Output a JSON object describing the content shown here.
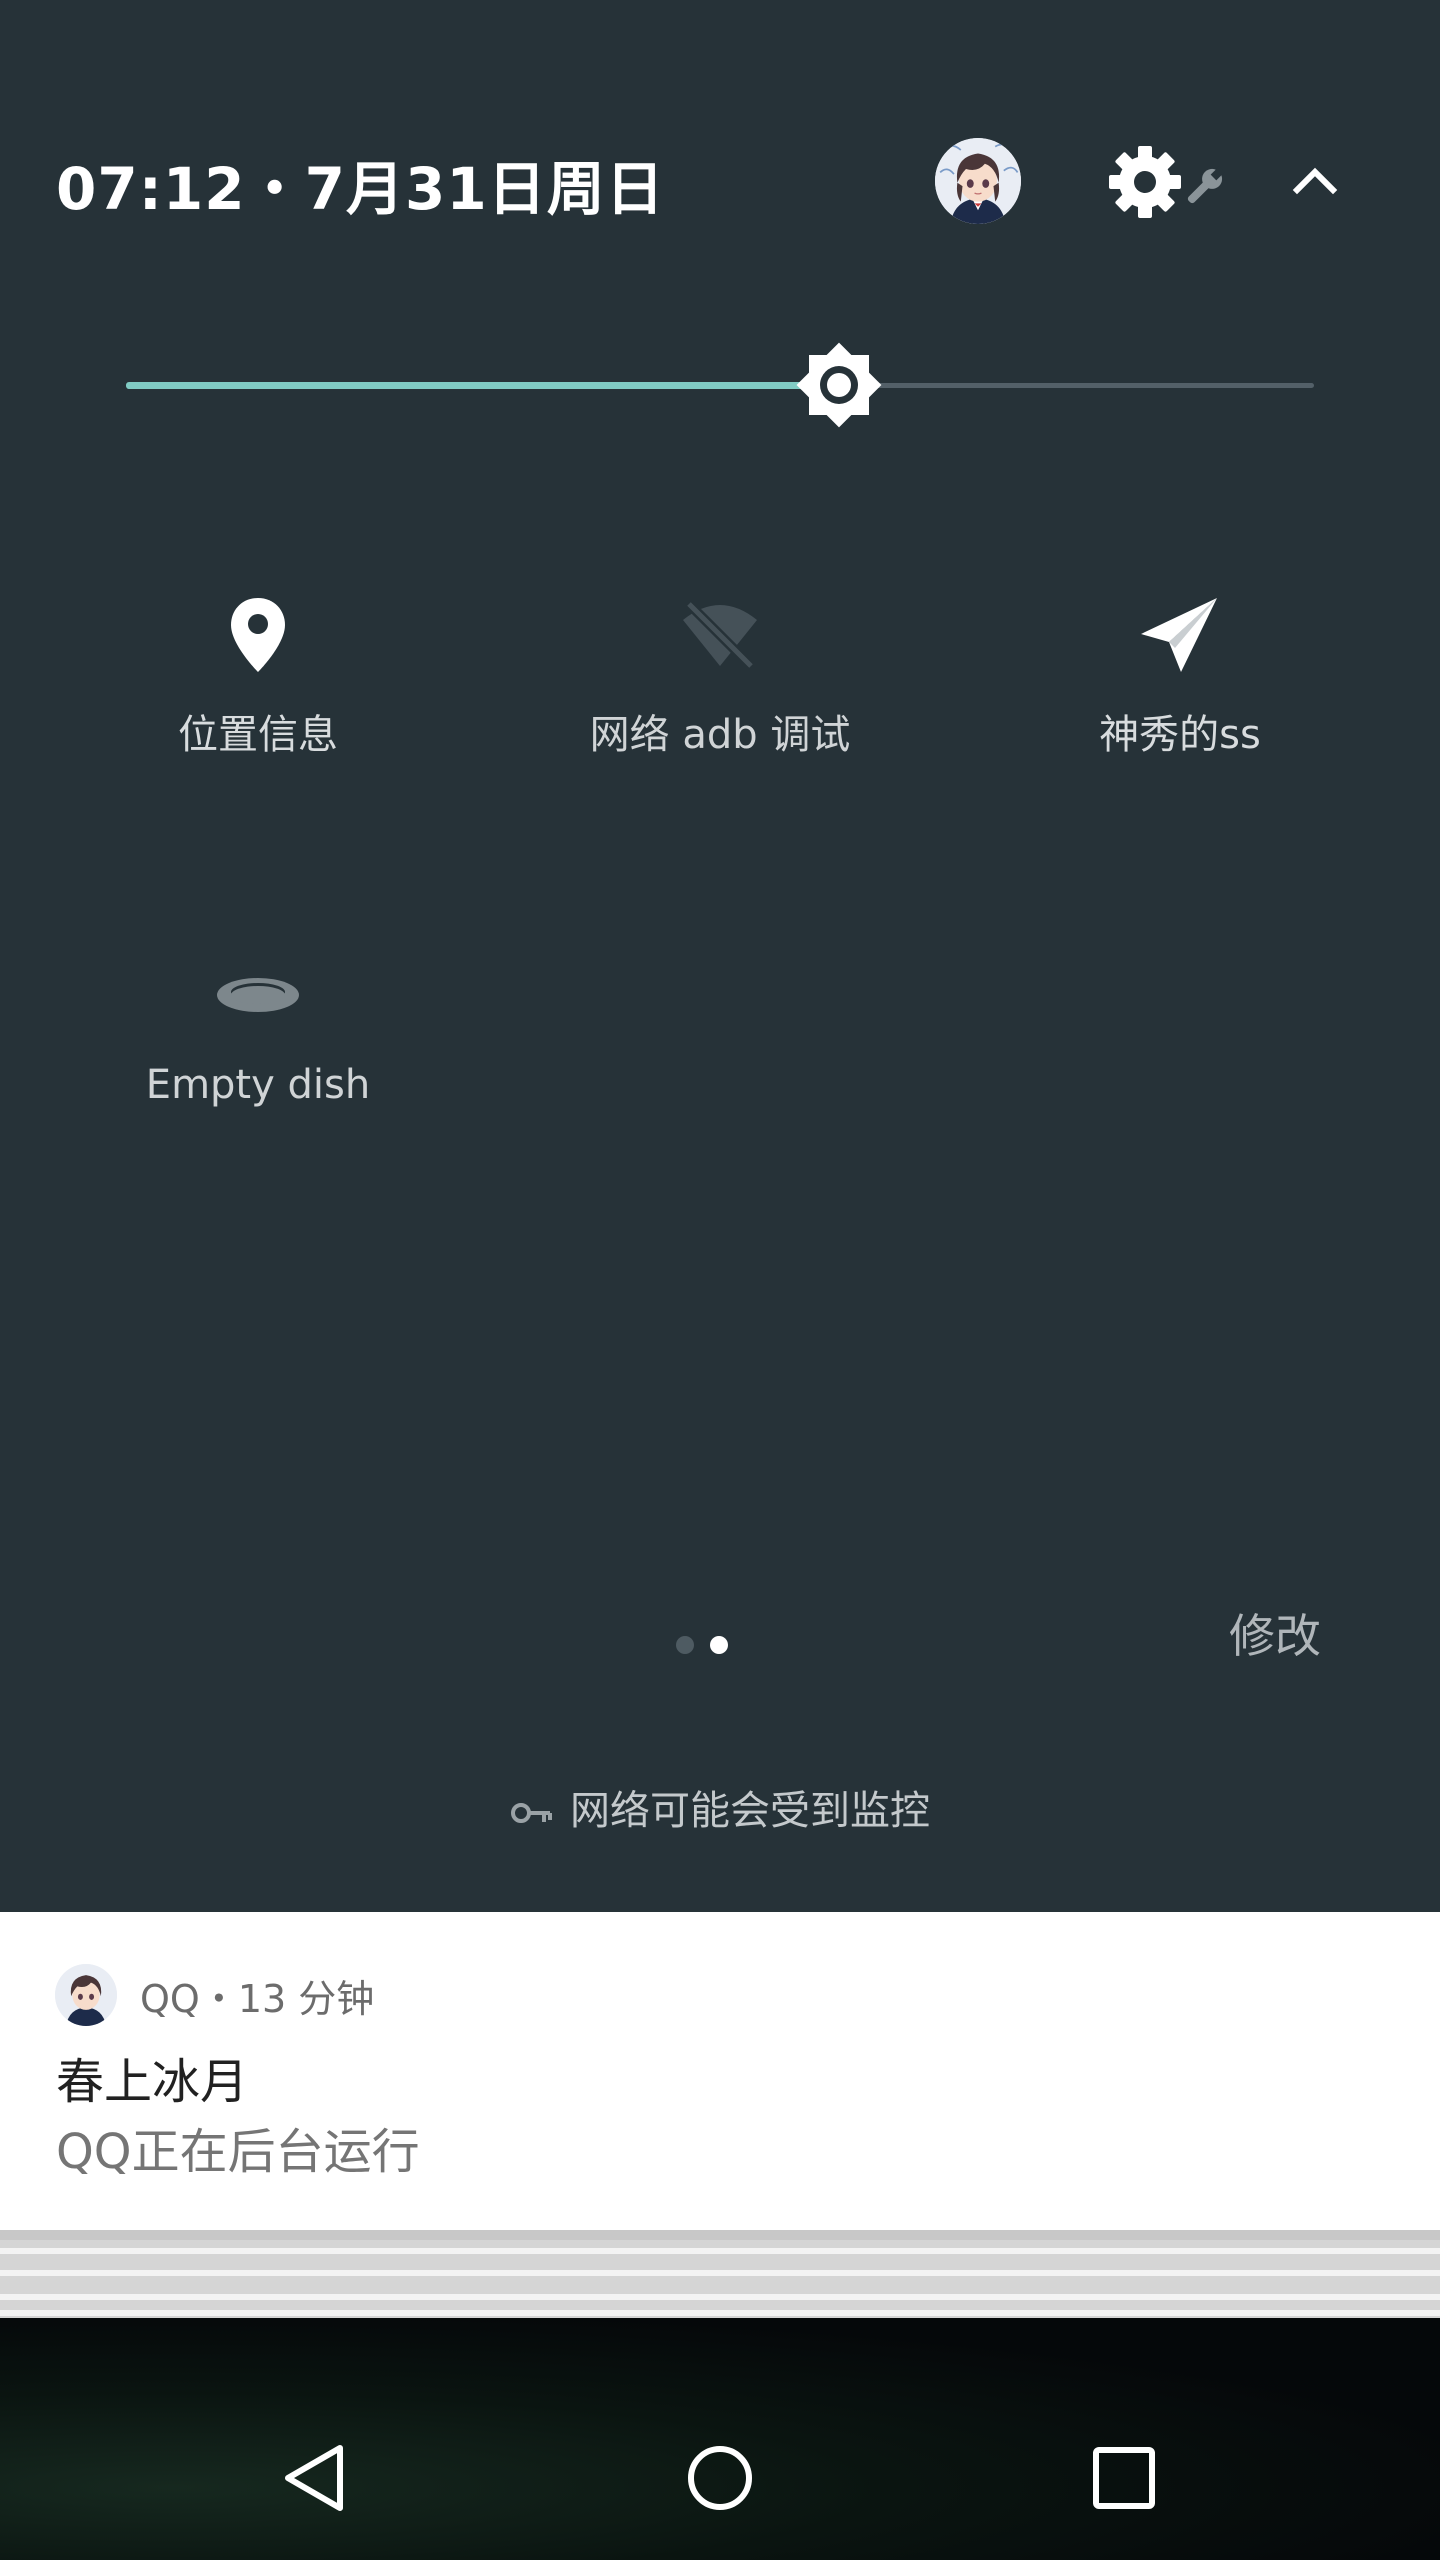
{
  "header": {
    "datetime": "07:12・7月31日周日"
  },
  "brightness": {
    "level": 0.6
  },
  "tiles": [
    {
      "label": "位置信息",
      "icon": "location-icon",
      "state": "on"
    },
    {
      "label": "网络 adb 调试",
      "icon": "adb-wifi-off-icon",
      "state": "off"
    },
    {
      "label": "神秀的ss",
      "icon": "send-icon",
      "state": "on"
    },
    {
      "label": "Empty dish",
      "icon": "empty-dish-icon",
      "state": "off"
    }
  ],
  "pager": {
    "current": 2,
    "total": 2
  },
  "edit_label": "修改",
  "monitor_notice": "网络可能会受到监控",
  "notification": {
    "meta": "QQ・13 分钟",
    "title": "春上冰月",
    "text": "QQ正在后台运行"
  },
  "colors": {
    "panel": "#263238",
    "accent": "#80cbc4",
    "notification_bg": "#ffffff"
  }
}
